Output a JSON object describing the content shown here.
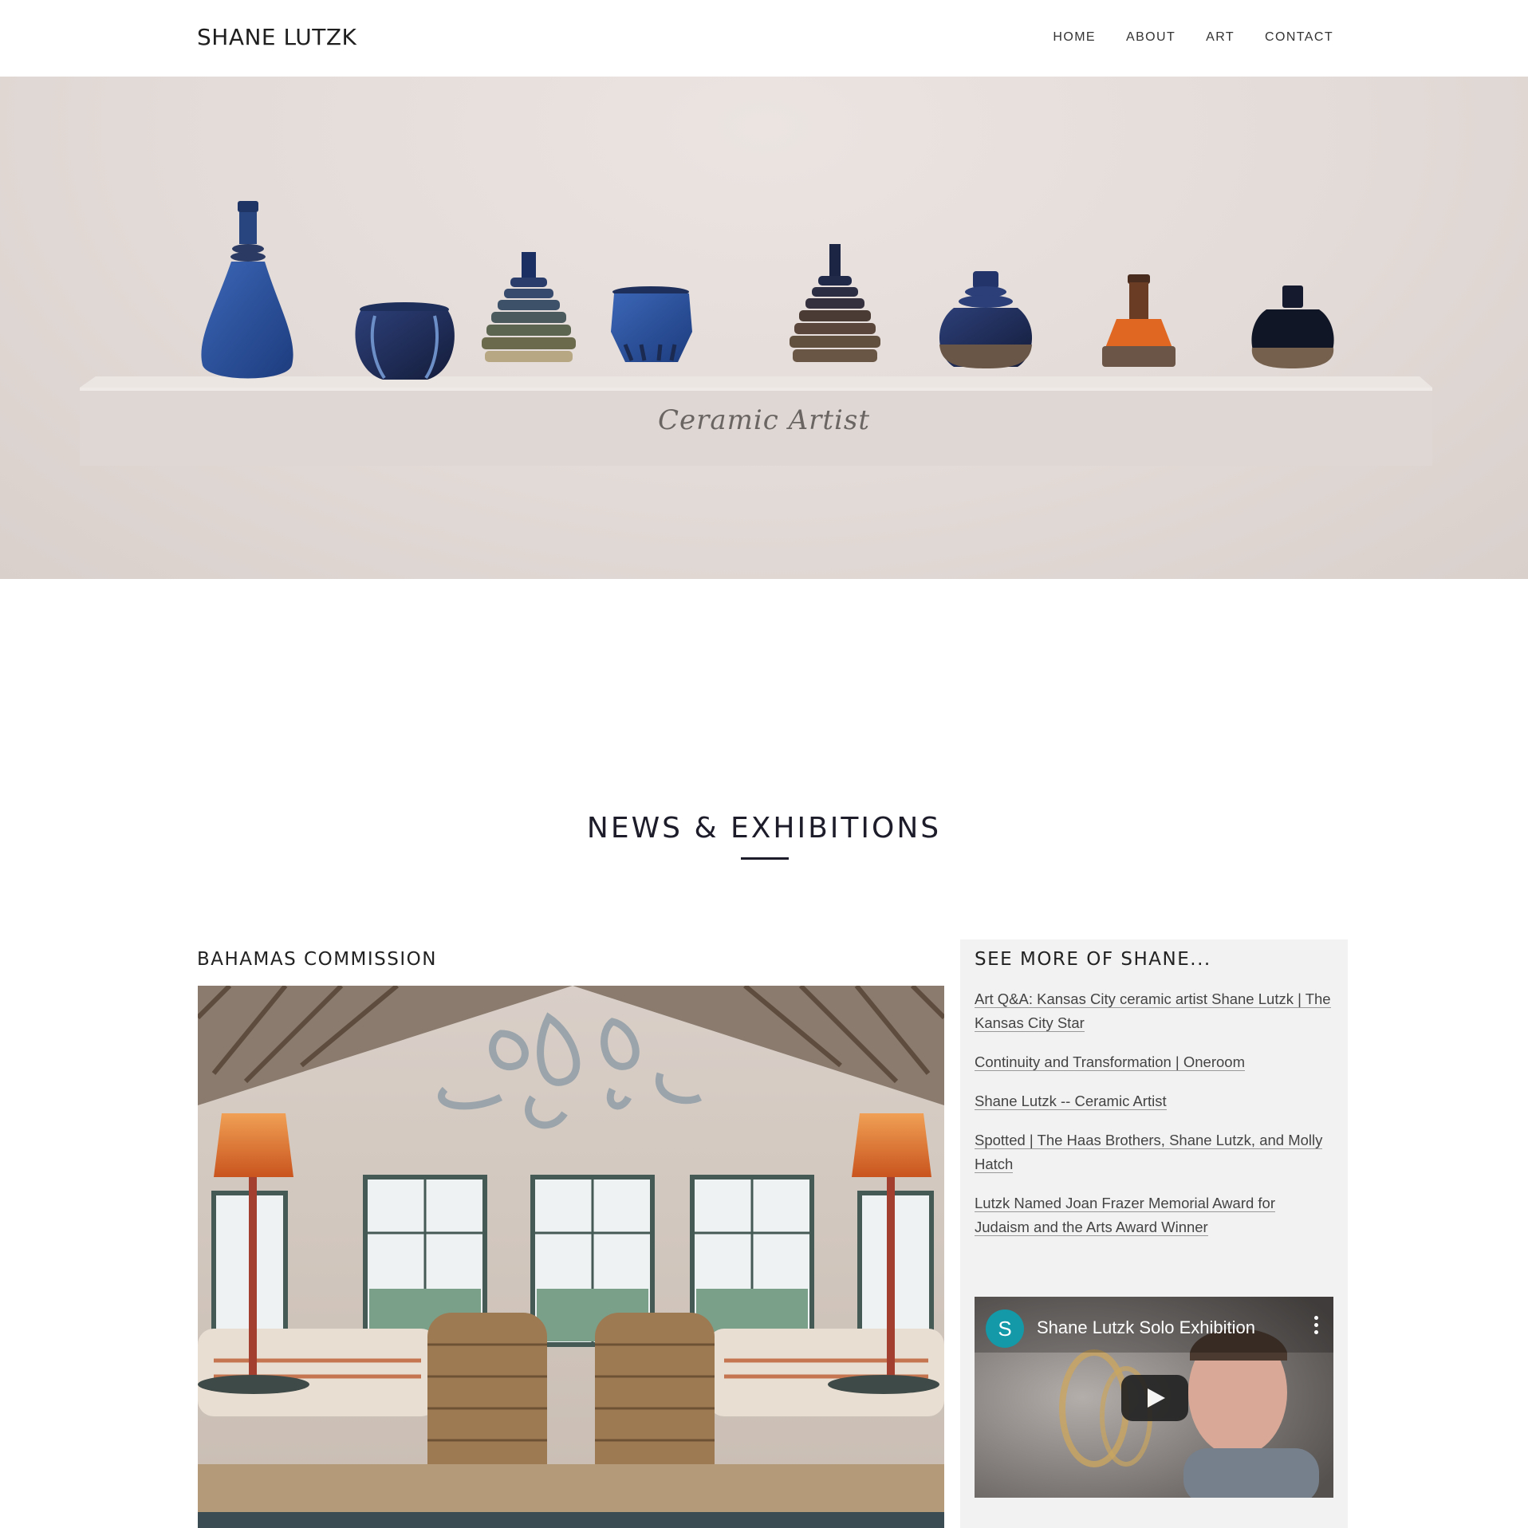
{
  "header": {
    "brand": "SHANE LUTZK",
    "nav": [
      "HOME",
      "ABOUT",
      "ART",
      "CONTACT"
    ]
  },
  "hero": {
    "caption": "Ceramic Artist"
  },
  "news": {
    "title": "NEWS & EXHIBITIONS",
    "main_title": "BAHAMAS COMMISSION"
  },
  "sidebar": {
    "title": "SEE MORE OF SHANE...",
    "links": [
      "Art Q&A: Kansas City ceramic artist Shane Lutzk | The Kansas City Star",
      "Continuity and Transformation | Oneroom",
      "Shane Lutzk -- Ceramic Artist",
      "Spotted | The Haas Brothers, Shane Lutzk, and Molly Hatch",
      "Lutzk Named Joan Frazer Memorial Award for Judaism and the Arts Award Winner"
    ],
    "video": {
      "channel_initial": "S",
      "title": "Shane Lutzk Solo Exhibition"
    }
  },
  "colors": {
    "accent_teal": "#1399a8",
    "text_dark": "#1c1c2a",
    "sidebar_bg": "#f2f2f2"
  }
}
